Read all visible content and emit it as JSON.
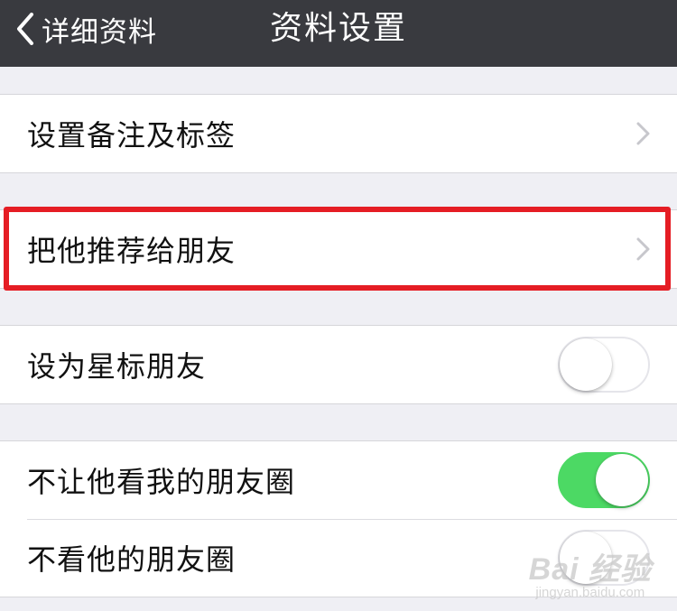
{
  "navbar": {
    "back_label": "详细资料",
    "title": "资料设置"
  },
  "groups": [
    {
      "label": "设置备注及标签",
      "type": "disclosure"
    },
    {
      "label": "把他推荐给朋友",
      "type": "disclosure",
      "highlighted": true
    },
    {
      "label": "设为星标朋友",
      "type": "toggle",
      "toggle_state": "off"
    },
    {
      "label": "不让他看我的朋友圈",
      "type": "toggle",
      "toggle_state": "on"
    },
    {
      "label": "不看他的朋友圈",
      "type": "toggle",
      "toggle_state": "off"
    }
  ],
  "colors": {
    "navbar_bg": "#393a3f",
    "page_bg": "#efeff4",
    "toggle_on": "#4cd964",
    "highlight_border": "#e51d24"
  },
  "icons": {
    "back": "chevron-left-icon",
    "disclosure": "chevron-right-icon"
  },
  "watermark": {
    "logo": "Bai 经验",
    "url": "jingyan.baidu.com"
  }
}
